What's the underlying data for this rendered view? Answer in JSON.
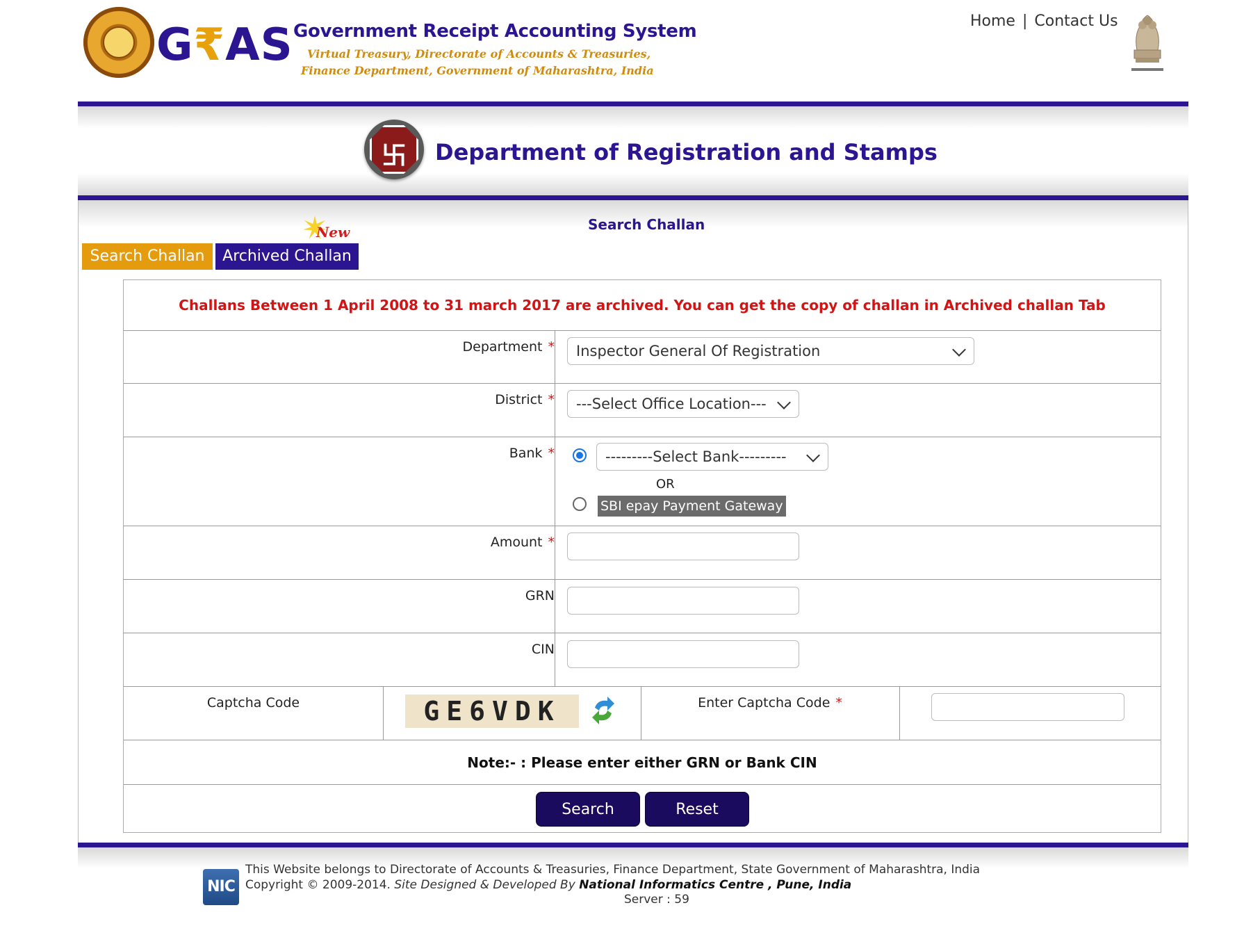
{
  "header": {
    "brand": {
      "g": "G",
      "rupee": "₹",
      "as": "AS"
    },
    "title": "Government Receipt Accounting System",
    "subtitle_1": "Virtual Treasury, Directorate of Accounts & Treasuries,",
    "subtitle_2": "Finance Department, Government of Maharashtra, India",
    "nav": {
      "home": "Home",
      "separator": "|",
      "contact": "Contact Us"
    }
  },
  "department": {
    "title": "Department of Registration and Stamps"
  },
  "page": {
    "section_title": "Search Challan",
    "tabs": [
      {
        "label": "Search Challan",
        "active": true
      },
      {
        "label": "Archived Challan",
        "active": false
      }
    ],
    "new_badge": "New",
    "colors": {
      "primary": "#2b1590",
      "tab_active": "#e49c0e",
      "notice": "#d41414"
    }
  },
  "form": {
    "notice": "Challans Between 1 April 2008 to 31 march 2017 are archived. You can get the copy of challan in Archived challan Tab",
    "required_mark": "*",
    "department": {
      "label": "Department",
      "value": "Inspector General Of Registration"
    },
    "district": {
      "label": "District",
      "value": "---Select Office Location---"
    },
    "bank": {
      "label": "Bank",
      "select_value": "---------Select Bank---------",
      "or": "OR",
      "gateway": "SBI epay Payment Gateway"
    },
    "amount": {
      "label": "Amount",
      "value": ""
    },
    "grn": {
      "label": "GRN",
      "value": ""
    },
    "cin": {
      "label": "CIN",
      "value": ""
    },
    "captcha": {
      "label": "Captcha Code",
      "code": "GE6VDK",
      "enter_label": "Enter Captcha Code",
      "value": ""
    },
    "note": "Note:- : Please enter either GRN or Bank CIN",
    "buttons": {
      "search": "Search",
      "reset": "Reset"
    }
  },
  "footer": {
    "line1": "This Website belongs to Directorate of Accounts & Treasuries, Finance Department, State Government of Maharashtra, India",
    "copyright": "Copyright © 2009-2014.",
    "designed_by": "Site Designed & Developed By",
    "developer": "National Informatics Centre , Pune, India",
    "server": "Server : 59",
    "nic_logo": "NIC"
  }
}
